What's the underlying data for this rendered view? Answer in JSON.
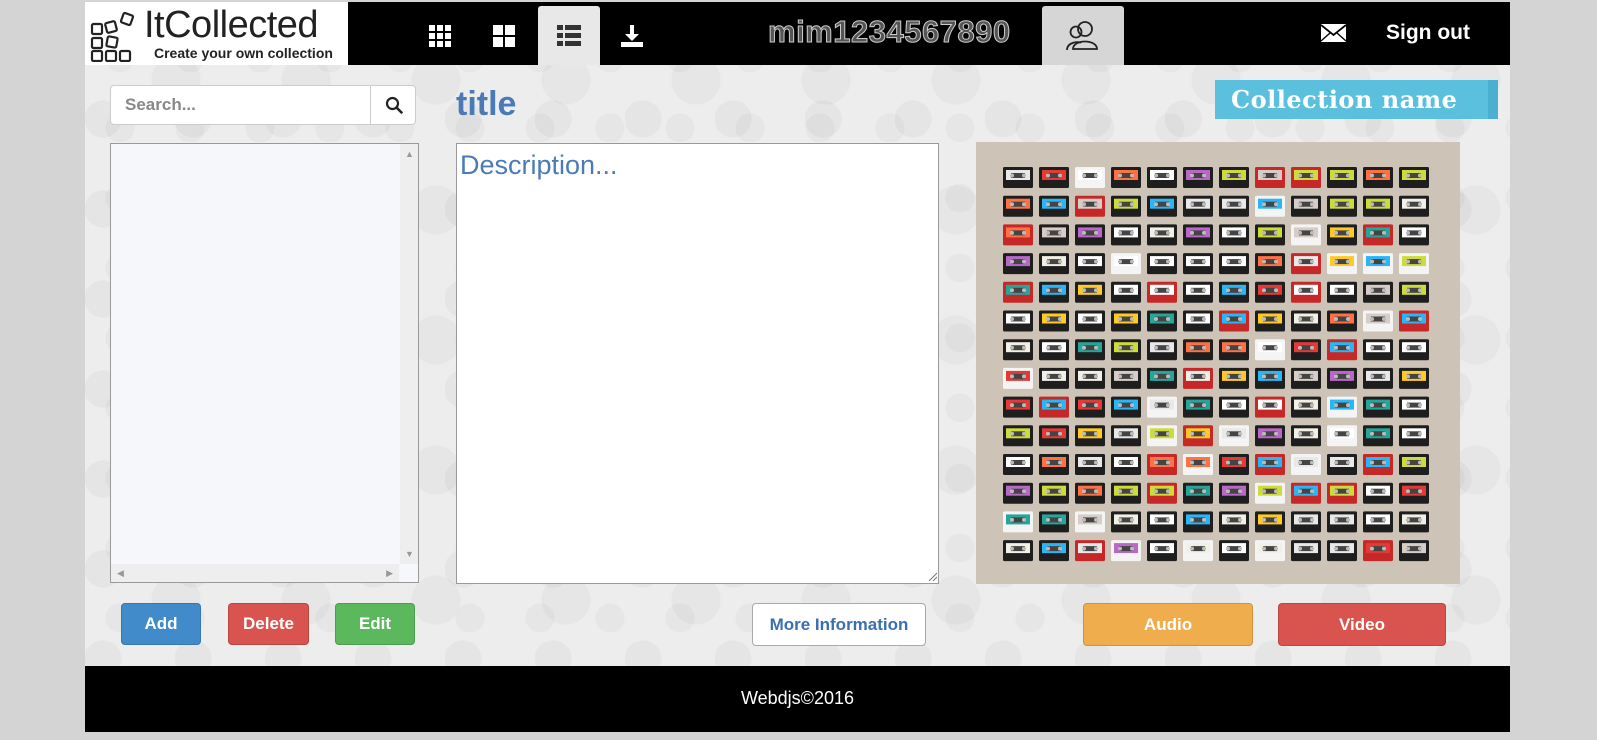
{
  "header": {
    "logo_name": "ItCollected",
    "logo_tagline": "Create your own collection",
    "nav_icons": [
      "grid-small-icon",
      "grid-large-icon",
      "list-icon",
      "download-icon"
    ],
    "active_nav": "list-icon",
    "username": "mim1234567890",
    "profile_icon": "users-icon",
    "mail_icon": "envelope-icon",
    "sign_out_label": "Sign out"
  },
  "sidebar": {
    "search_placeholder": "Search...",
    "search_icon": "search-icon",
    "items": [],
    "add_label": "Add",
    "delete_label": "Delete",
    "edit_label": "Edit"
  },
  "item": {
    "title": "title",
    "description_placeholder": "Description...",
    "more_info_label": "More Information"
  },
  "collection": {
    "name": "Collection name",
    "image_subject": "cassette-tapes-grid",
    "audio_label": "Audio",
    "video_label": "Video"
  },
  "footer": {
    "text": "Webdjs©2016"
  },
  "colors": {
    "primary": "#428bca",
    "danger": "#d9534f",
    "success": "#5cb85c",
    "warning": "#f0ad4e",
    "info": "#5bc0de",
    "title_blue": "#4a7bb7",
    "topbar": "#000000"
  }
}
